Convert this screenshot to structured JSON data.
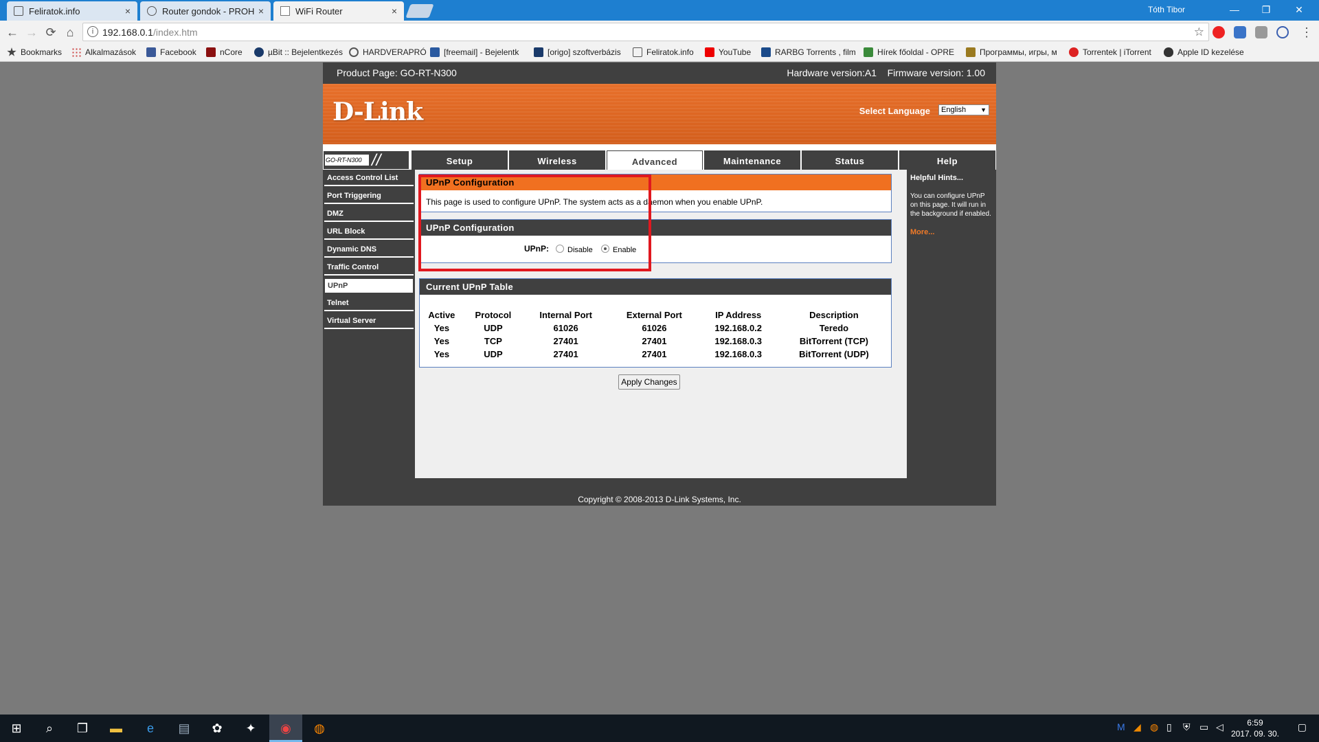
{
  "browser": {
    "tabs": [
      {
        "title": "Feliratok.info",
        "active": false
      },
      {
        "title": "Router gondok - PROHA",
        "active": false
      },
      {
        "title": "WiFi Router",
        "active": true
      }
    ],
    "tab_close": "×",
    "user": "Tóth Tibor",
    "window_buttons": {
      "minimize": "—",
      "restore": "❐",
      "close": "✕"
    },
    "nav": {
      "back": "←",
      "forward": "→",
      "reload": "⟳",
      "home": "⌂"
    },
    "url_host": "192.168.0.1",
    "url_path": "/index.htm",
    "info_icon": "i",
    "star": "☆",
    "menu": "⋮",
    "bookmarks": [
      {
        "label": "Bookmarks",
        "color": "#444"
      },
      {
        "label": "Alkalmazások",
        "color": "#c44"
      },
      {
        "label": "Facebook",
        "color": "#3b5998"
      },
      {
        "label": "nCore",
        "color": "#8a1010"
      },
      {
        "label": "µBit :: Bejelentkezés",
        "color": "#1a3a6a"
      },
      {
        "label": "HARDVERAPRÓ",
        "color": "#555"
      },
      {
        "label": "[freemail] - Bejelentk",
        "color": "#2a5aa0"
      },
      {
        "label": "[origo] szoftverbázis",
        "color": "#1a3a6a"
      },
      {
        "label": "Feliratok.info",
        "color": "#555"
      },
      {
        "label": "YouTube",
        "color": "#e00"
      },
      {
        "label": "RARBG Torrents , film",
        "color": "#1a4a8a"
      },
      {
        "label": "Hírek főoldal - OPRE",
        "color": "#3a8a3a"
      },
      {
        "label": "Программы, игры, м",
        "color": "#9a7a20"
      },
      {
        "label": "Torrentek | iTorrent",
        "color": "#d22"
      },
      {
        "label": "Apple ID kezelése",
        "color": "#333"
      }
    ]
  },
  "router": {
    "product": "Product Page: GO-RT-N300",
    "versions": "Hardware version:A1    Firmware version: 1.00",
    "logo": "D-Link",
    "select_language": "Select Language",
    "language": "English",
    "model": "GO-RT-N300",
    "tabs": [
      "Setup",
      "Wireless",
      "Advanced",
      "Maintenance",
      "Status",
      "Help"
    ],
    "active_tab": "Advanced",
    "sidebar": [
      "Access Control List",
      "Port Triggering",
      "DMZ",
      "URL Block",
      "Dynamic DNS",
      "Traffic Control",
      "UPnP",
      "Telnet",
      "Virtual Server"
    ],
    "active_sidebar": "UPnP",
    "intro_title": "UPnP Configuration",
    "intro_text": "This page is used to configure UPnP. The system acts as a daemon when you enable UPnP.",
    "config_title": "UPnP Configuration",
    "upnp_label": "UPnP:",
    "disable_label": "Disable",
    "enable_label": "Enable",
    "upnp_selected": "Enable",
    "table_title": "Current UPnP Table",
    "table_headers": [
      "Active",
      "Protocol",
      "Internal Port",
      "External Port",
      "IP Address",
      "Description"
    ],
    "table_rows": [
      [
        "Yes",
        "UDP",
        "61026",
        "61026",
        "192.168.0.2",
        "Teredo"
      ],
      [
        "Yes",
        "TCP",
        "27401",
        "27401",
        "192.168.0.3",
        "BitTorrent (TCP)"
      ],
      [
        "Yes",
        "UDP",
        "27401",
        "27401",
        "192.168.0.3",
        "BitTorrent (UDP)"
      ]
    ],
    "apply_button": "Apply Changes",
    "hints_title": "Helpful Hints...",
    "hints_text": "You can configure UPnP on this page. It will run in the background if enabled.",
    "hints_more": "More...",
    "copyright": "Copyright © 2008-2013 D-Link Systems, Inc."
  },
  "taskbar": {
    "time": "6:59",
    "date": "2017. 09. 30."
  }
}
